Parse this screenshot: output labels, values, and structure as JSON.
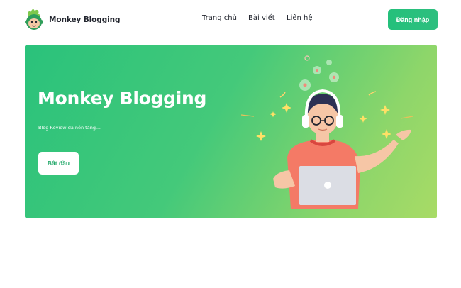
{
  "header": {
    "brand": "Monkey Blogging",
    "nav": [
      "Trang chủ",
      "Bài viết",
      "Liên hệ"
    ],
    "login_label": "Đăng nhập"
  },
  "hero": {
    "title": "Monkey Blogging",
    "subtitle": "Blog Review đa nền tảng....",
    "start_label": "Bắt đầu"
  },
  "colors": {
    "primary": "#2ebf7f",
    "gradient_start": "#2ac27b",
    "gradient_end": "#a8db66",
    "text": "#23262f"
  },
  "icons": [
    "monkey-logo-icon",
    "person-with-laptop-illustration"
  ]
}
